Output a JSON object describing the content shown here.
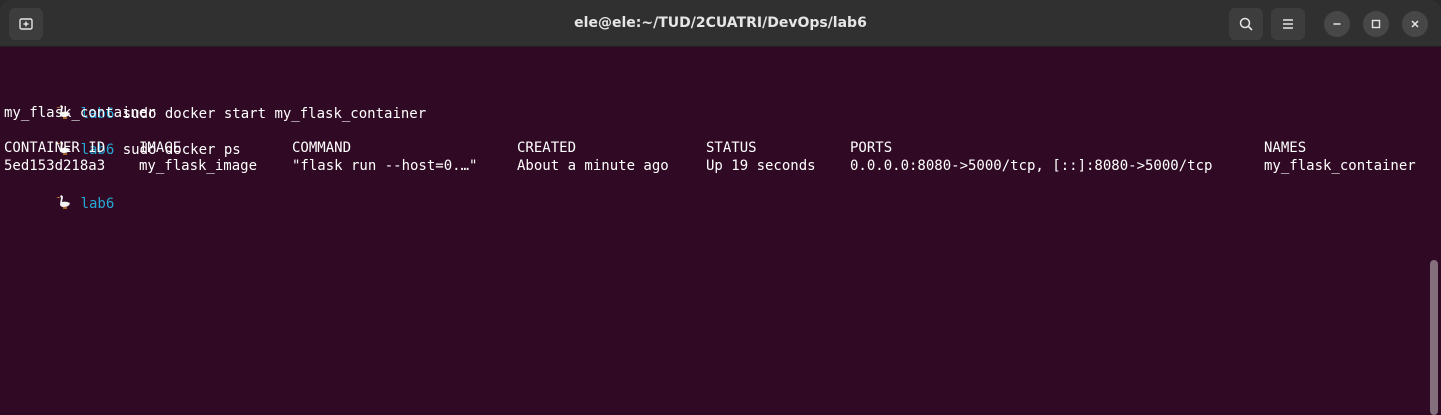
{
  "window": {
    "title": "ele@ele:~/TUD/2CUATRI/DevOps/lab6"
  },
  "header_buttons": {
    "new_tab_icon": "new-tab-icon",
    "search_icon": "search-icon",
    "menu_icon": "hamburger-menu-icon",
    "minimize_icon": "minimize-icon",
    "maximize_icon": "maximize-icon",
    "close_icon": "close-icon"
  },
  "colors": {
    "background": "#300a24",
    "titlebar": "#303030",
    "prompt_dir": "#26a7d6",
    "text": "#ffffff"
  },
  "terminal": {
    "prompt_dir": "lab6",
    "lines": [
      {
        "type": "prompt",
        "command": " sudo docker start my_flask_container"
      },
      {
        "type": "output",
        "text": "my_flask_container"
      },
      {
        "type": "prompt",
        "command": " sudo docker ps"
      }
    ],
    "ps_table": {
      "headers": [
        "CONTAINER ID",
        "IMAGE",
        "COMMAND",
        "CREATED",
        "STATUS",
        "PORTS",
        "NAMES"
      ],
      "rows": [
        [
          "5ed153d218a3",
          "my_flask_image",
          "\"flask run --host=0.…\"",
          "About a minute ago",
          "Up 19 seconds",
          "0.0.0.0:8080->5000/tcp, [::]:8080->5000/tcp",
          "my_flask_container"
        ]
      ]
    },
    "final_prompt": {
      "type": "prompt",
      "command": ""
    }
  }
}
